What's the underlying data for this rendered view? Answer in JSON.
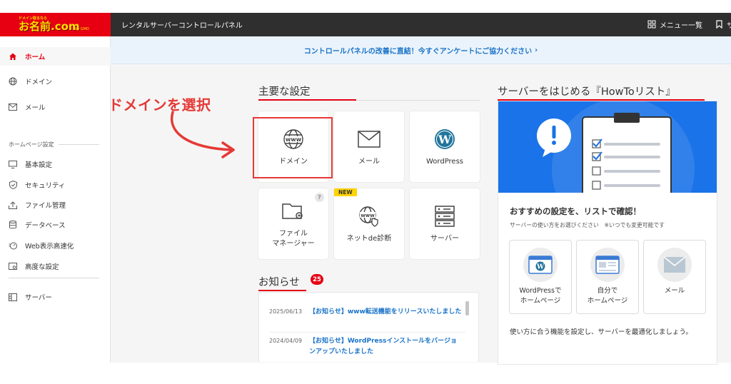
{
  "header": {
    "logo_sub": "ドメイン取るなら",
    "logo_main": "お名前.com",
    "logo_tiny": "by GMO",
    "title": "レンタルサーバーコントロールパネル",
    "menu_label": "メニュー一覧",
    "bookmark_label": "サ"
  },
  "sidebar": {
    "items": [
      {
        "label": "ホーム",
        "icon": "home-icon"
      },
      {
        "label": "ドメイン",
        "icon": "globe-icon"
      },
      {
        "label": "メール",
        "icon": "mail-icon"
      }
    ],
    "section_label": "ホームページ設定",
    "section_items": [
      {
        "label": "基本設定",
        "icon": "monitor-icon"
      },
      {
        "label": "セキュリティ",
        "icon": "shield-icon"
      },
      {
        "label": "ファイル管理",
        "icon": "upload-icon"
      },
      {
        "label": "データベース",
        "icon": "database-icon"
      },
      {
        "label": "Web表示高速化",
        "icon": "speed-icon"
      },
      {
        "label": "高度な設定",
        "icon": "advanced-icon"
      }
    ],
    "bottom_items": [
      {
        "label": "サーバー",
        "icon": "server-icon"
      }
    ]
  },
  "banner": {
    "text": "コントロールパネルの改善に直結！今すぐアンケートにご協力ください",
    "chevron": "›"
  },
  "main_settings": {
    "title": "主要な設定",
    "cards": [
      {
        "label": "ドメイン",
        "icon": "www-globe-icon"
      },
      {
        "label": "メール",
        "icon": "envelope-icon"
      },
      {
        "label": "WordPress",
        "icon": "wordpress-icon"
      },
      {
        "label": "ファイル\nマネージャー",
        "icon": "folder-gear-icon",
        "badge": "?"
      },
      {
        "label": "ネットde診断",
        "icon": "www-shield-icon",
        "badge": "NEW"
      },
      {
        "label": "サーバー",
        "icon": "server-rack-icon"
      }
    ]
  },
  "annotation": {
    "text": "ドメインを選択",
    "color": "#e53935"
  },
  "news": {
    "title": "お知らせ",
    "count": "25",
    "items": [
      {
        "date": "2025/06/13",
        "text": "【お知らせ】www転送機能をリリースいたしました"
      },
      {
        "date": "2024/04/09",
        "text": "【お知らせ】WordPressインストールをバージョンアップいたしました"
      }
    ]
  },
  "howto": {
    "title": "サーバーをはじめる『HowToリスト』",
    "heading": "おすすめの設定を、リストで確認！",
    "subheading": "サーバーの使い方をお選びください　※いつでも変更可能です",
    "options": [
      {
        "label": "WordPressで\nホームページ",
        "icon": "wordpress-window-icon"
      },
      {
        "label": "自分で\nホームページ",
        "icon": "layout-window-icon"
      },
      {
        "label": "メール",
        "icon": "envelope-icon"
      }
    ],
    "footer": "使い方に合う機能を設定し、サーバーを最適化しましょう。"
  },
  "colors": {
    "brand_red": "#e60012",
    "link_blue": "#1a73c8",
    "hero_blue": "#1a73e8",
    "new_yellow": "#ffd400"
  }
}
